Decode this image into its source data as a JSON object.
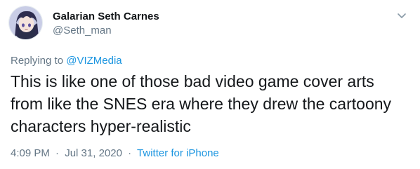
{
  "author": {
    "display_name": "Galarian Seth Carnes",
    "handle": "@Seth_man"
  },
  "reply": {
    "prefix": "Replying to ",
    "mention": "@VIZMedia"
  },
  "tweet": {
    "text": "This is like one of those bad video game cover arts from like the SNES era where they drew the cartoony characters hyper-realistic"
  },
  "meta": {
    "time": "4:09 PM",
    "separator": "·",
    "date": "Jul 31, 2020",
    "source": "Twitter for iPhone"
  },
  "icons": {
    "avatar": "anime-avatar",
    "menu": "chevron-down-icon"
  },
  "colors": {
    "link": "#1b95e0",
    "secondary_text": "#657786",
    "primary_text": "#14171a"
  }
}
